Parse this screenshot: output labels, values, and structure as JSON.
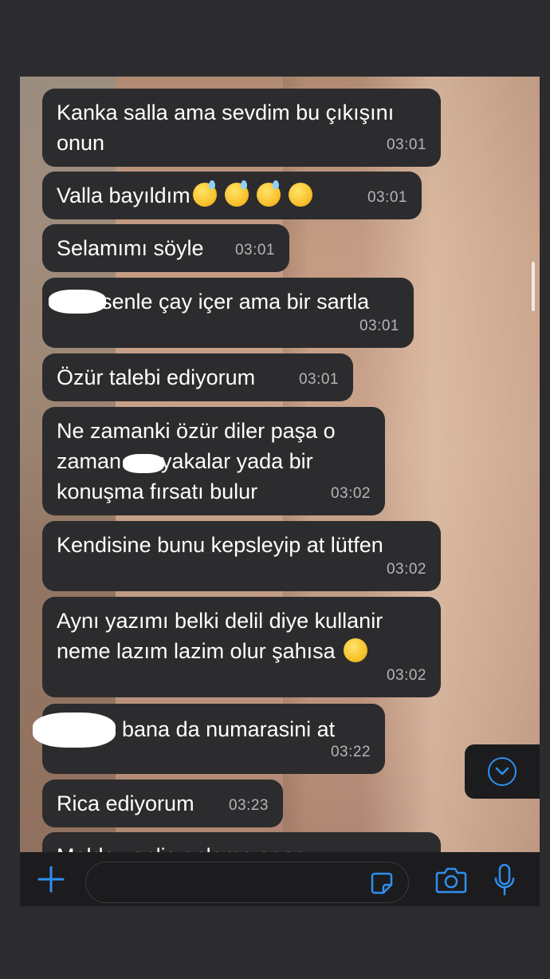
{
  "messages": [
    {
      "text": "Kanka salla ama sevdim bu çıkışını\nonun",
      "time": "03:01"
    },
    {
      "text": "Valla bayıldım",
      "emojis": [
        "grinning-sweat-emoji",
        "grinning-sweat-emoji",
        "grinning-sweat-emoji",
        "winking-emoji"
      ],
      "time": "03:01"
    },
    {
      "text": "Selamımı söyle",
      "time": "03:01"
    },
    {
      "text": "senle çay içer ama bir sartla",
      "time": "03:01"
    },
    {
      "text": "Özür talebi ediyorum",
      "time": "03:01"
    },
    {
      "text_line1_before": "Ne zamanki özür diler paşa o",
      "text_line2_before": "zaman",
      "text_line2_after": "yakalar yada bir",
      "text_line3": "konuşma fırsatı bulur",
      "time": "03:02"
    },
    {
      "text": "Kendisine bunu kepsleyip at lütfen",
      "time": "03:02"
    },
    {
      "text": "Aynı yazımı belki delil diye kullanir\nneme lazım lazim olur şahısa ",
      "time": "03:02"
    },
    {
      "text": "bana da numarasini at",
      "time": "03:22"
    },
    {
      "text": "Rica ediyorum",
      "time": "03:23"
    },
    {
      "text": "Melda yanlis anlama sana",
      "time": ""
    }
  ],
  "input": {
    "placeholder": ""
  },
  "icons": {
    "plus": "plus-icon",
    "sticker": "sticker-icon",
    "camera": "camera-icon",
    "mic": "microphone-icon",
    "scroll_down": "chevron-down-icon"
  },
  "colors": {
    "accent": "#2f8fef",
    "bubble": "#2c2c2e",
    "bar": "#1c1c1e"
  }
}
